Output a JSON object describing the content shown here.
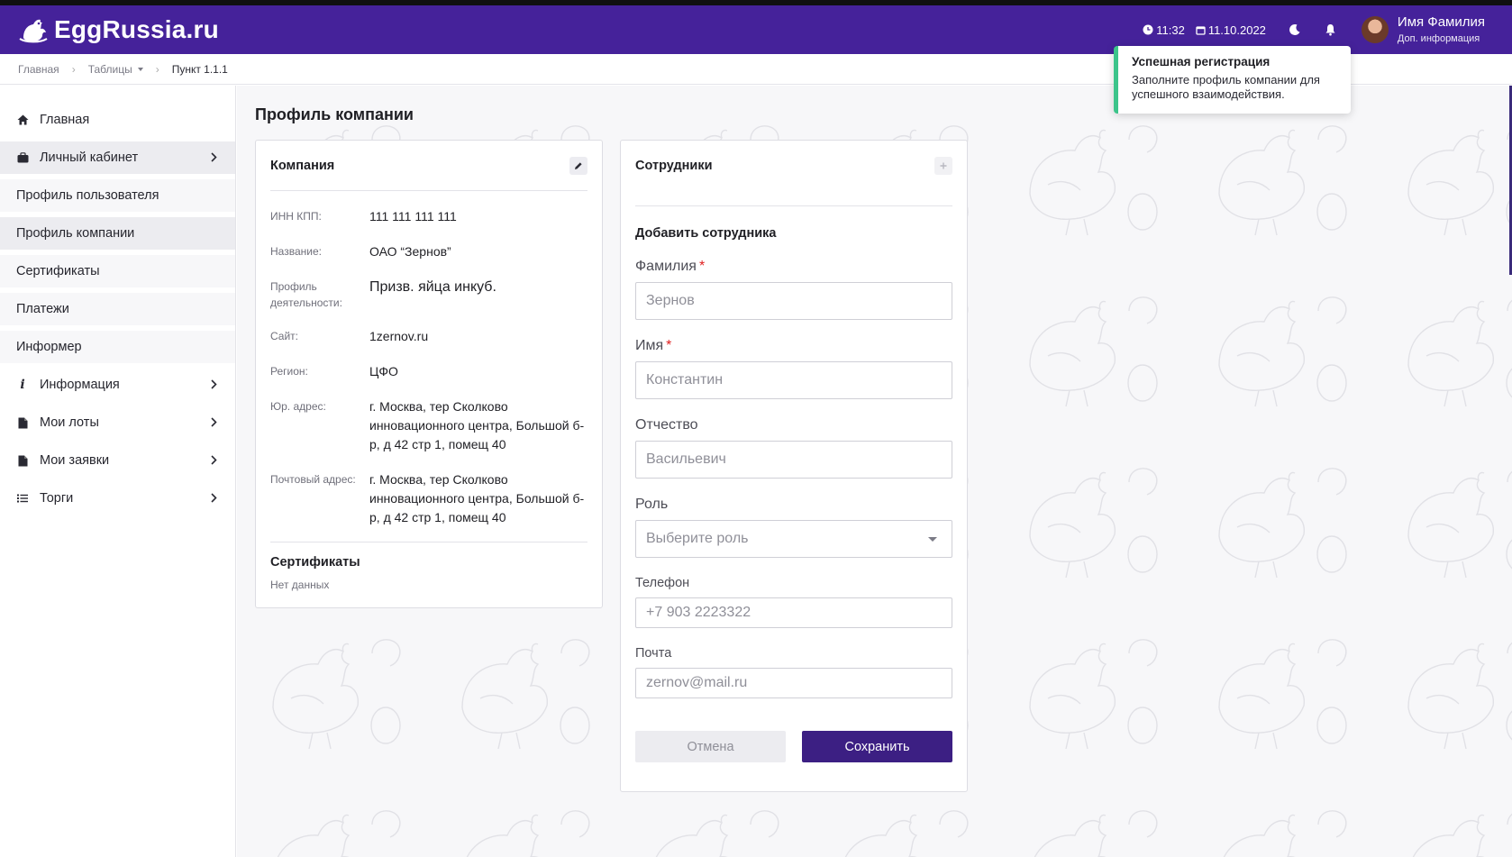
{
  "header": {
    "logo_text": "EggRussia.ru",
    "time": "11:32",
    "date": "11.10.2022",
    "user_name": "Имя Фамилия",
    "user_sub": "Доп. информация",
    "brand_color": "#45229a"
  },
  "breadcrumb": {
    "items": [
      "Главная",
      "Таблицы",
      "Пункт 1.1.1"
    ]
  },
  "sidebar": {
    "items": [
      {
        "label": "Главная",
        "icon": "home-icon"
      },
      {
        "label": "Личный кабинет",
        "icon": "briefcase-icon"
      },
      {
        "label": "Профиль пользователя"
      },
      {
        "label": "Профиль компании"
      },
      {
        "label": "Сертификаты"
      },
      {
        "label": "Платежи"
      },
      {
        "label": "Информер"
      },
      {
        "label": "Информация",
        "icon": "info-icon"
      },
      {
        "label": "Мои лоты",
        "icon": "document-icon"
      },
      {
        "label": "Мои заявки",
        "icon": "document-icon"
      },
      {
        "label": "Торги",
        "icon": "list-icon"
      }
    ]
  },
  "page": {
    "title": "Профиль компании"
  },
  "company": {
    "title": "Компания",
    "fields": [
      {
        "label": "ИНН КПП:",
        "value": "111 111 111 111"
      },
      {
        "label": "Название:",
        "value": "ОАО “Зернов”"
      },
      {
        "label": "Профиль деятельности:",
        "value": "Призв. яйца инкуб."
      },
      {
        "label": "Сайт:",
        "value": "1zernov.ru"
      },
      {
        "label": "Регион:",
        "value": "ЦФО"
      },
      {
        "label": "Юр. адрес:",
        "value": "г. Москва, тер Сколково инновационного центра, Большой б-р, д 42 стр 1, помещ 40"
      },
      {
        "label": "Почтовый адрес:",
        "value": "г. Москва, тер Сколково инновационного центра, Большой б-р, д 42 стр 1, помещ 40"
      }
    ],
    "certificates_title": "Сертификаты",
    "certificates_empty": "Нет данных"
  },
  "employees": {
    "title": "Сотрудники",
    "form_title": "Добавить сотрудника",
    "fields": {
      "last_name_label": "Фамилия",
      "last_name_placeholder": "Зернов",
      "first_name_label": "Имя",
      "first_name_placeholder": "Константин",
      "middle_name_label": "Отчество",
      "middle_name_placeholder": "Васильевич",
      "role_label": "Роль",
      "role_placeholder": "Выберите роль",
      "phone_label": "Телефон",
      "phone_placeholder": "+7 903 2223322",
      "email_label": "Почта",
      "email_placeholder": "zernov@mail.ru"
    },
    "required_mark": "*",
    "cancel_label": "Отмена",
    "save_label": "Сохранить"
  },
  "toast": {
    "title": "Успешная регистрация",
    "text": "Заполните профиль компании для успешного взаимодействия.",
    "accent": "#3cc48a"
  }
}
